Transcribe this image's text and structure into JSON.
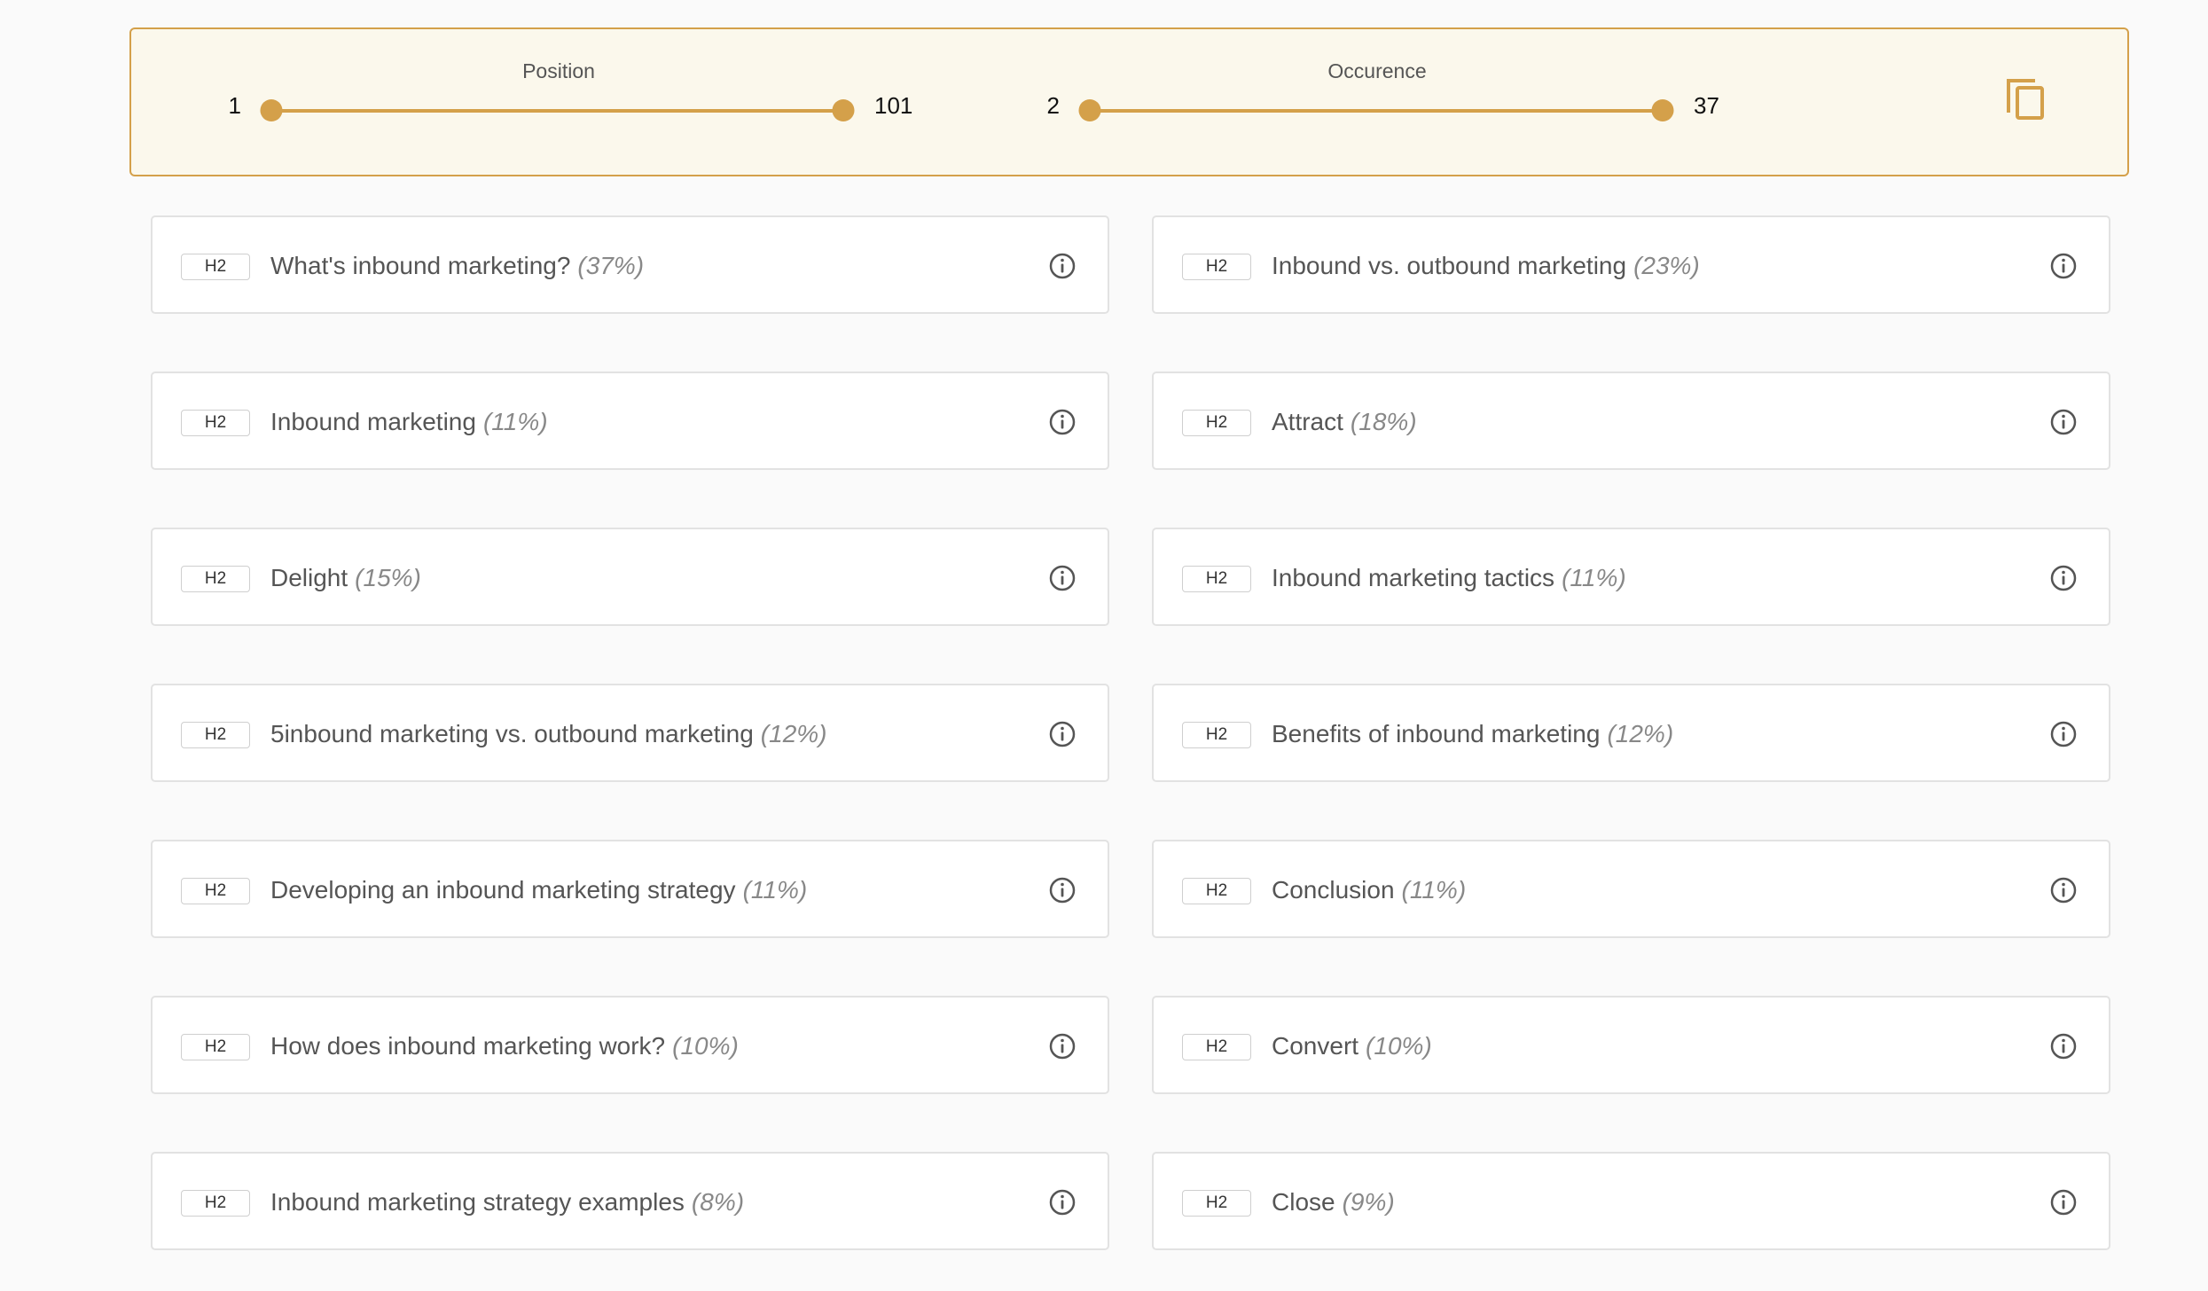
{
  "filters": {
    "position": {
      "title": "Position",
      "min": "1",
      "max": "101"
    },
    "occurrence": {
      "title": "Occurence",
      "min": "2",
      "max": "37"
    },
    "accent_color": "#d4a04a",
    "copy_icon": "copy-icon"
  },
  "headings": [
    {
      "tag": "H2",
      "text": "What's inbound marketing?",
      "pct": "(37%)"
    },
    {
      "tag": "H2",
      "text": "Inbound vs. outbound marketing",
      "pct": "(23%)"
    },
    {
      "tag": "H2",
      "text": "Inbound marketing",
      "pct": "(11%)"
    },
    {
      "tag": "H2",
      "text": "Attract",
      "pct": "(18%)"
    },
    {
      "tag": "H2",
      "text": "Delight",
      "pct": "(15%)"
    },
    {
      "tag": "H2",
      "text": "Inbound marketing tactics",
      "pct": "(11%)"
    },
    {
      "tag": "H2",
      "text": "5inbound marketing vs. outbound marketing",
      "pct": "(12%)"
    },
    {
      "tag": "H2",
      "text": "Benefits of inbound marketing",
      "pct": "(12%)"
    },
    {
      "tag": "H2",
      "text": "Developing an inbound marketing strategy",
      "pct": "(11%)"
    },
    {
      "tag": "H2",
      "text": "Conclusion",
      "pct": "(11%)"
    },
    {
      "tag": "H2",
      "text": "How does inbound marketing work?",
      "pct": "(10%)"
    },
    {
      "tag": "H2",
      "text": "Convert",
      "pct": "(10%)"
    },
    {
      "tag": "H2",
      "text": "Inbound marketing strategy examples",
      "pct": "(8%)"
    },
    {
      "tag": "H2",
      "text": "Close",
      "pct": "(9%)"
    }
  ]
}
